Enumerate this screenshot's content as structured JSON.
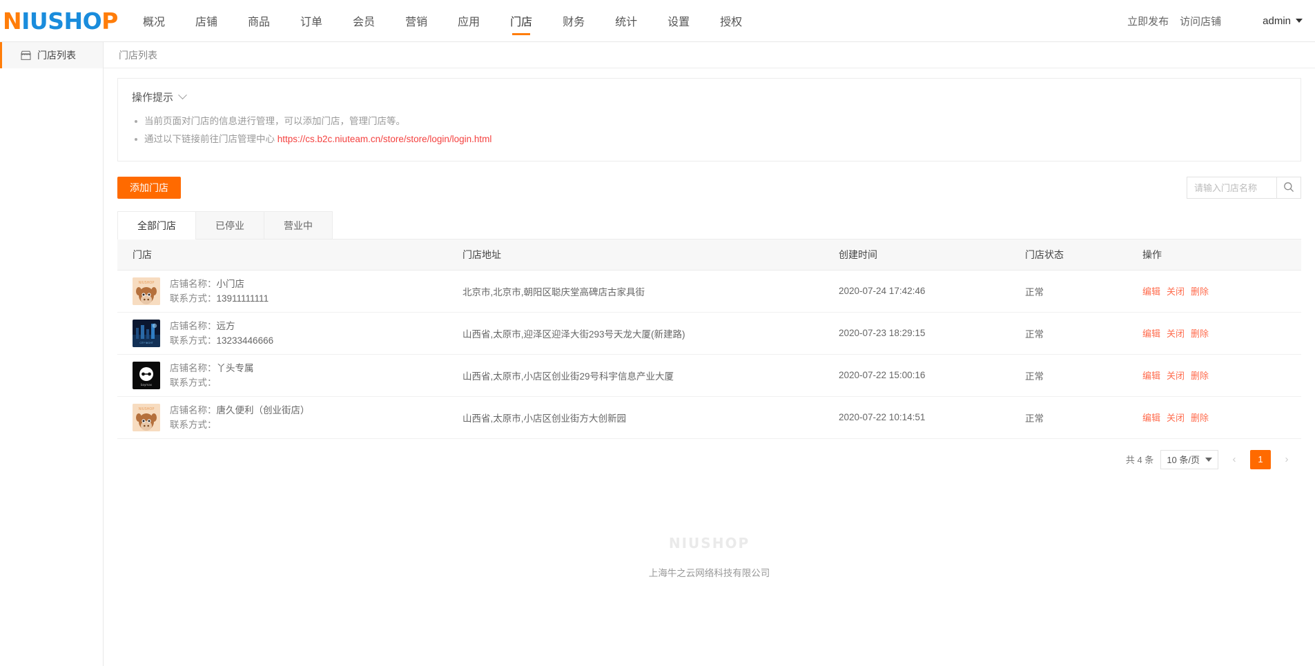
{
  "header": {
    "logo": {
      "part1": "N",
      "part2": "IUSHO",
      "part3": "P"
    },
    "nav": [
      {
        "label": "概况",
        "active": false
      },
      {
        "label": "店铺",
        "active": false
      },
      {
        "label": "商品",
        "active": false
      },
      {
        "label": "订单",
        "active": false
      },
      {
        "label": "会员",
        "active": false
      },
      {
        "label": "营销",
        "active": false
      },
      {
        "label": "应用",
        "active": false
      },
      {
        "label": "门店",
        "active": true
      },
      {
        "label": "财务",
        "active": false
      },
      {
        "label": "统计",
        "active": false
      },
      {
        "label": "设置",
        "active": false
      },
      {
        "label": "授权",
        "active": false
      }
    ],
    "publish_label": "立即发布",
    "visit_shop_label": "访问店铺",
    "account_label": "admin"
  },
  "sidebar": {
    "items": [
      {
        "label": "门店列表",
        "icon": "shop-icon",
        "active": true
      }
    ]
  },
  "breadcrumb": "门店列表",
  "tips": {
    "title": "操作提示",
    "items": [
      {
        "text": "当前页面对门店的信息进行管理，可以添加门店，管理门店等。",
        "link": ""
      },
      {
        "text": "通过以下链接前往门店管理中心 ",
        "link": "https://cs.b2c.niuteam.cn/store/store/login/login.html"
      }
    ]
  },
  "toolbar": {
    "add_label": "添加门店",
    "search_placeholder": "请输入门店名称",
    "search_value": ""
  },
  "tabs": [
    {
      "label": "全部门店",
      "active": true
    },
    {
      "label": "已停业",
      "active": false
    },
    {
      "label": "营业中",
      "active": false
    }
  ],
  "table": {
    "columns": [
      "门店",
      "门店地址",
      "创建时间",
      "门店状态",
      "操作"
    ],
    "row_labels": {
      "name": "店铺名称：",
      "contact": "联系方式："
    },
    "actions": [
      "编辑",
      "关闭",
      "删除"
    ],
    "rows": [
      {
        "name": "小门店",
        "contact": "13911111111",
        "address": "北京市,北京市,朝阳区聪庆堂高碑店古家具街",
        "created": "2020-07-24 17:42:46",
        "status": "正常",
        "avatar": "niushop-cow"
      },
      {
        "name": "远方",
        "contact": "13233446666",
        "address": "山西省,太原市,迎泽区迎泽大街293号天龙大厦(新建路)",
        "created": "2020-07-23 18:29:15",
        "status": "正常",
        "avatar": "night-city"
      },
      {
        "name": "丫头专属",
        "contact": "",
        "address": "山西省,太原市,小店区创业街29号科宇信息产业大厦",
        "created": "2020-07-22 15:00:16",
        "status": "正常",
        "avatar": "baymax"
      },
      {
        "name": "唐久便利（创业街店）",
        "contact": "",
        "address": "山西省,太原市,小店区创业街方大创新园",
        "created": "2020-07-22 10:14:51",
        "status": "正常",
        "avatar": "niushop-cow"
      }
    ]
  },
  "pagination": {
    "total_text": "共 4 条",
    "page_size_label": "10 条/页",
    "current_page": "1",
    "prev_icon": "‹",
    "next_icon": "›"
  },
  "footer": {
    "watermark": "NIUSHOP",
    "company": "上海牛之云网络科技有限公司"
  },
  "colors": {
    "accent": "#ff6a00",
    "link": "#f4413f",
    "action": "#ff6d4f",
    "logo_blue": "#1a8cdc"
  }
}
